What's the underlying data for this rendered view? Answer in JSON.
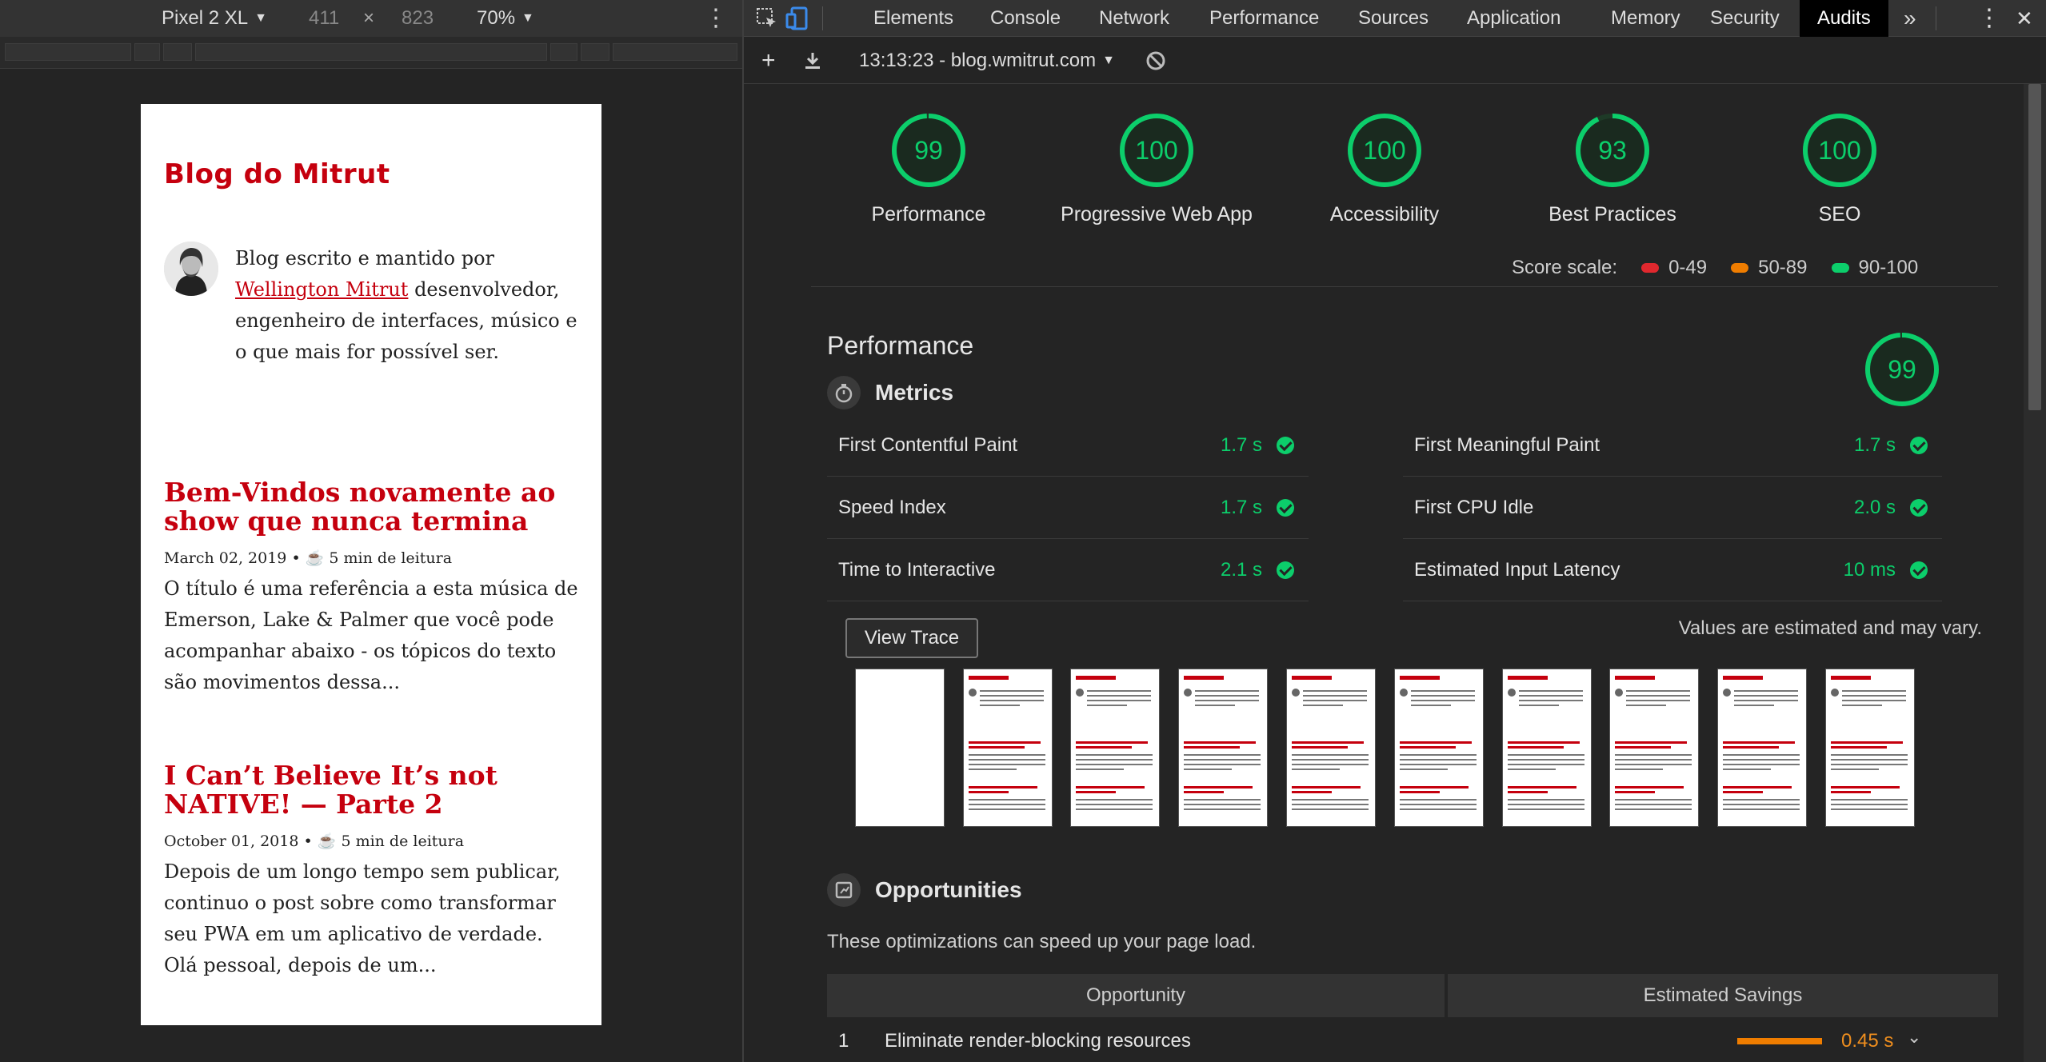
{
  "device_toolbar": {
    "device_name": "Pixel 2 XL",
    "width": "411",
    "times": "×",
    "height": "823",
    "zoom": "70%"
  },
  "blog": {
    "title": "Blog do Mitrut",
    "bio_prefix": "Blog escrito e mantido por",
    "bio_link": "Wellington Mitrut",
    "bio_suffix": "desenvolvedor, engenheiro de interfaces, músico e o que mais for possível ser.",
    "posts": [
      {
        "title": "Bem-Vindos novamente ao show que nunca termina",
        "date": "March 02, 2019",
        "read_time": "5 min de leitura",
        "excerpt": "O título é uma referência a esta música de Emerson, Lake & Palmer que você pode acompanhar abaixo - os tópicos do texto são movimentos dessa..."
      },
      {
        "title": "I Can’t Believe It’s not NATIVE! — Parte 2",
        "date": "October 01, 2018",
        "read_time": "5 min de leitura",
        "excerpt": "Depois de um longo tempo sem publicar, continuo o post sobre como transformar seu PWA em um aplicativo de verdade. Olá pessoal, depois de um..."
      }
    ],
    "meta_separator": "• ☕"
  },
  "devtools": {
    "tabs": [
      "Elements",
      "Console",
      "Network",
      "Performance",
      "Sources",
      "Application",
      "Memory",
      "Security",
      "Audits"
    ],
    "active_tab": "Audits",
    "more_tabs": "»",
    "audit_report": "13:13:23 - blog.wmitrut.com"
  },
  "gauges": [
    {
      "score": "99",
      "label": "Performance",
      "value": 0.99
    },
    {
      "score": "100",
      "label": "Progressive Web App",
      "value": 1.0
    },
    {
      "score": "100",
      "label": "Accessibility",
      "value": 1.0
    },
    {
      "score": "93",
      "label": "Best Practices",
      "value": 0.93
    },
    {
      "score": "100",
      "label": "SEO",
      "value": 1.0
    }
  ],
  "score_scale": {
    "label": "Score scale:",
    "ranges": [
      {
        "range": "0-49",
        "color": "#e0282e"
      },
      {
        "range": "50-89",
        "color": "#ef7d00"
      },
      {
        "range": "90-100",
        "color": "#0cce6b"
      }
    ]
  },
  "performance": {
    "title": "Performance",
    "score": "99",
    "metrics_heading": "Metrics",
    "metrics": [
      {
        "name": "First Contentful Paint",
        "value": "1.7 s"
      },
      {
        "name": "First Meaningful Paint",
        "value": "1.7 s"
      },
      {
        "name": "Speed Index",
        "value": "1.7 s"
      },
      {
        "name": "First CPU Idle",
        "value": "2.0 s"
      },
      {
        "name": "Time to Interactive",
        "value": "2.1 s"
      },
      {
        "name": "Estimated Input Latency",
        "value": "10 ms"
      }
    ],
    "view_trace": "View Trace",
    "estimate_note": "Values are estimated and may vary."
  },
  "opportunities": {
    "heading": "Opportunities",
    "description": "These optimizations can speed up your page load.",
    "col_opportunity": "Opportunity",
    "col_savings": "Estimated Savings",
    "rows": [
      {
        "index": "1",
        "name": "Eliminate render-blocking resources",
        "savings": "0.45 s"
      }
    ]
  },
  "colors": {
    "pass": "#0cce6b",
    "average": "#ef7d00",
    "fail": "#e0282e",
    "brand_red": "#c5000e"
  }
}
